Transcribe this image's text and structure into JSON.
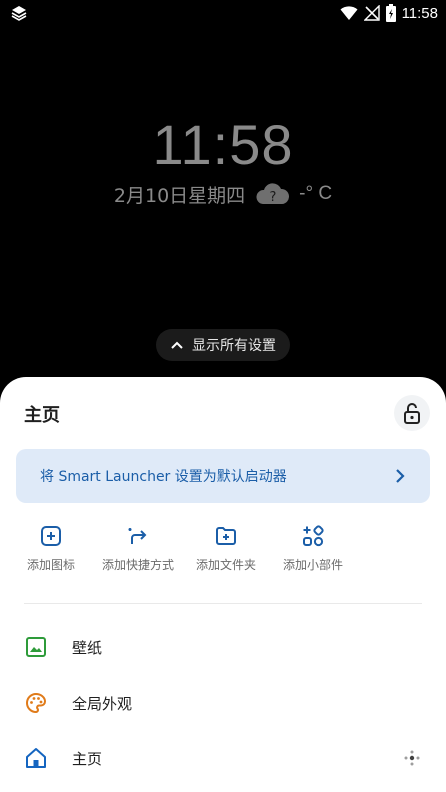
{
  "status_bar": {
    "time": "11:58",
    "app_icon": "layers-icon",
    "wifi_icon": "wifi-icon",
    "signal_icon": "no-signal-icon",
    "battery_icon": "battery-charging-icon"
  },
  "lockscreen": {
    "clock": "11:58",
    "date": "2月10日星期四",
    "weather_icon": "cloud-question-icon",
    "temperature": "-° C",
    "show_all_label": "显示所有设置"
  },
  "sheet": {
    "title": "主页",
    "lock_icon": "unlock-icon",
    "banner_text": "将 Smart Launcher 设置为默认启动器",
    "actions": [
      {
        "label": "添加图标",
        "icon": "add-square-icon"
      },
      {
        "label": "添加快捷方式",
        "icon": "shortcut-arrow-icon"
      },
      {
        "label": "添加文件夹",
        "icon": "add-folder-icon"
      },
      {
        "label": "添加小部件",
        "icon": "add-widget-icon"
      }
    ],
    "menu": [
      {
        "label": "壁纸",
        "icon": "wallpaper-icon"
      },
      {
        "label": "全局外观",
        "icon": "palette-icon"
      },
      {
        "label": "主页",
        "icon": "home-icon"
      }
    ]
  },
  "colors": {
    "accent_blue": "#1b5ea8",
    "banner_bg": "#dfeaf8",
    "wallpaper_green": "#2e9b3a",
    "palette_orange": "#e07b1a",
    "home_blue": "#1565c0"
  }
}
